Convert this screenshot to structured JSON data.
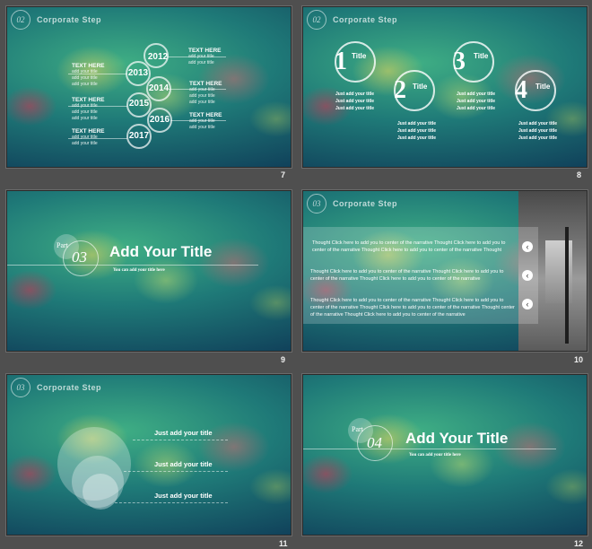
{
  "slides": [
    {
      "number": "7",
      "header": {
        "badge": "02",
        "title": "Corporate   Step"
      },
      "years": [
        "2012",
        "2013",
        "2014",
        "2015",
        "2016",
        "2017"
      ],
      "left_tags": [
        {
          "heading": "TEXT HERE",
          "lines": [
            "add your title",
            "add your title",
            "add your title"
          ]
        },
        {
          "heading": "TEXT HERE",
          "lines": [
            "add your title",
            "add your title",
            "add your title"
          ]
        },
        {
          "heading": "TEXT HERE",
          "lines": [
            "add your title",
            "add your title"
          ]
        }
      ],
      "right_tags": [
        {
          "heading": "TEXT HERE",
          "lines": [
            "add your title",
            "add your title"
          ]
        },
        {
          "heading": "TEXT HERE",
          "lines": [
            "add your title",
            "add your title",
            "add your title"
          ]
        },
        {
          "heading": "TEXT HERE",
          "lines": [
            "add your title",
            "add your title"
          ]
        }
      ]
    },
    {
      "number": "8",
      "header": {
        "badge": "02",
        "title": "Corporate   Step"
      },
      "steps": [
        {
          "num": "1",
          "title": "Title",
          "lines": [
            "Just add your title",
            "Just add your title",
            "Just add your title"
          ]
        },
        {
          "num": "2",
          "title": "Title",
          "lines": [
            "Just add your title",
            "Just add your title",
            "Just add your title"
          ]
        },
        {
          "num": "3",
          "title": "Title",
          "lines": [
            "Just add your title",
            "Just add your title",
            "Just add your title"
          ]
        },
        {
          "num": "4",
          "title": "Title",
          "lines": [
            "Just add your title",
            "Just add your title",
            "Just add your title"
          ]
        }
      ]
    },
    {
      "number": "9",
      "part_label": "Part",
      "part_num": "03",
      "title": "Add Your Title",
      "subtitle": "You can add your title here"
    },
    {
      "number": "10",
      "header": {
        "badge": "03",
        "title": "Corporate   Step"
      },
      "paragraphs": [
        "Thought Click here to add you to center of the narrative Thought Click here to add you to center of the narrative Thought Click here to add you to center of the narrative Thought",
        "Thought Click here to add you to center of the narrative Thought Click here to add you to center of the narrative Thought Click here to add you to center of the narrative",
        "Thought Click here to add you to center of the narrative Thought Click here to add you to center of the narrative Thought Click here to add you to center of the narrative Thought center of the narrative Thought Click here to add you to center of the narrative"
      ]
    },
    {
      "number": "11",
      "header": {
        "badge": "03",
        "title": "Corporate   Step"
      },
      "items": [
        "Just add your title",
        "Just add your title",
        "Just add your title"
      ]
    },
    {
      "number": "12",
      "part_label": "Part",
      "part_num": "04",
      "title": "Add Your Title",
      "subtitle": "You can add your title here"
    }
  ]
}
